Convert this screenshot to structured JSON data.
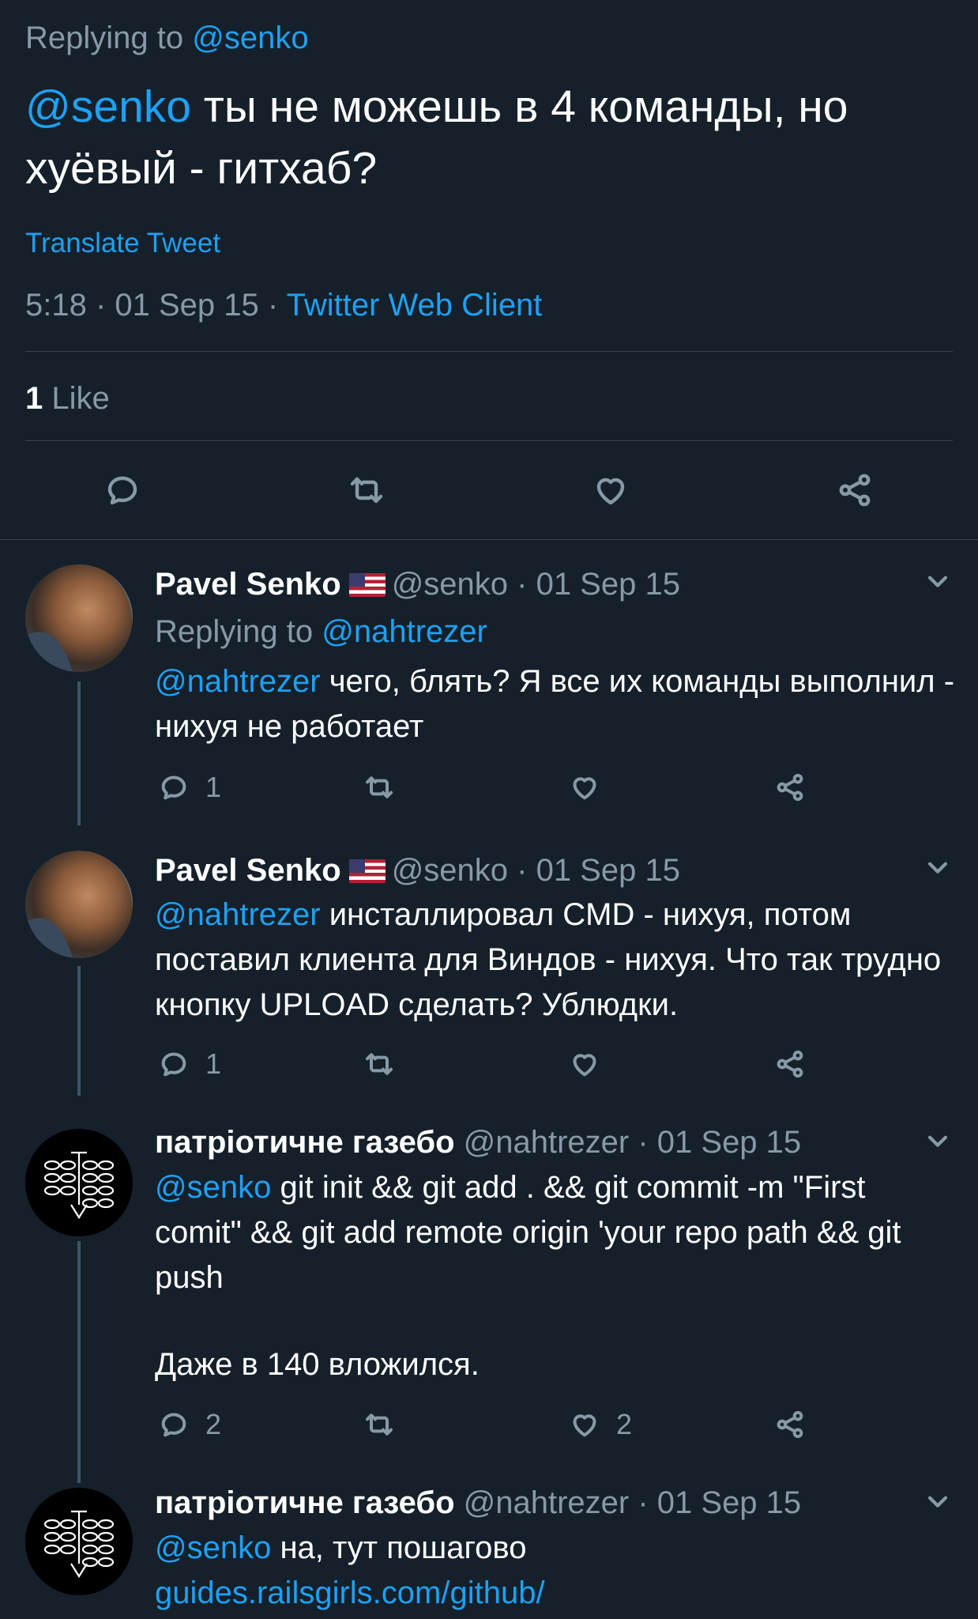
{
  "main_tweet": {
    "replying_prefix": "Replying to",
    "replying_handle": "@senko",
    "mention": "@senko",
    "text": " ты не можешь в 4 команды, но хуёвый - гитхаб?",
    "translate_label": "Translate Tweet",
    "time": "5:18 · 01 Sep 15 · ",
    "client": "Twitter Web Client",
    "likes_count": "1",
    "likes_label": "Like"
  },
  "replies": [
    {
      "name": "Pavel Senko",
      "handle_date": "@senko · 01 Sep 15",
      "replying_prefix": "Replying to",
      "replying_handle": "@nahtrezer",
      "mention": "@nahtrezer",
      "text": " чего, блять? Я все их команды выполнил - нихуя не работает",
      "reply_count": "1",
      "like_count": ""
    },
    {
      "name": "Pavel Senko",
      "handle_date": "@senko · 01 Sep 15",
      "mention": "@nahtrezer",
      "text": " инсталлировал CMD - нихуя, потом поставил клиента для Виндов - нихуя. Что так трудно кнопку UPLOAD сделать? Ублюдки.",
      "reply_count": "1",
      "like_count": ""
    },
    {
      "name": "патріотичне газебо",
      "handle_date": "@nahtrezer · 01 Sep 15",
      "mention": "@senko",
      "text": " git init && git add . && git commit -m \"First comit\" && git add remote origin 'your repo path && git push",
      "text2": "Даже в 140 вложился.",
      "reply_count": "2",
      "like_count": "2"
    },
    {
      "name": "патріотичне газебо",
      "handle_date": "@nahtrezer · 01 Sep 15",
      "mention": "@senko",
      "text": " на, тут пошагово ",
      "link": "guides.railsgirls.com/github/"
    }
  ],
  "icons": {
    "reply": "reply-icon",
    "retweet": "retweet-icon",
    "like": "heart-icon",
    "share": "share-icon",
    "more": "chevron-down-icon"
  },
  "colors": {
    "background": "#15202b",
    "link": "#1da1f2",
    "muted": "#8899a6",
    "divider": "#38444d"
  }
}
